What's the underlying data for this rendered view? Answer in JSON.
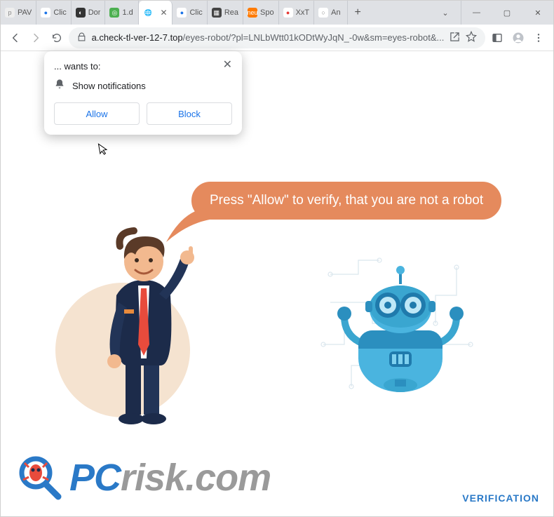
{
  "tabs": [
    {
      "label": "PAV",
      "fav": "p",
      "favbg": "#eee",
      "favcolor": "#888"
    },
    {
      "label": "Clic",
      "fav": "●",
      "favbg": "#fff",
      "favcolor": "#1a73e8"
    },
    {
      "label": "Dor",
      "fav": "◐",
      "favbg": "#333",
      "favcolor": "#fff"
    },
    {
      "label": "1.d",
      "fav": "◎",
      "favbg": "#4caf50",
      "favcolor": "#fff"
    },
    {
      "label": "",
      "fav": "🌐",
      "favbg": "#fff",
      "favcolor": "#555",
      "active": true
    },
    {
      "label": "Clic",
      "fav": "●",
      "favbg": "#fff",
      "favcolor": "#1a73e8"
    },
    {
      "label": "Rea",
      "fav": "▦",
      "favbg": "#444",
      "favcolor": "#fff"
    },
    {
      "label": "Spo",
      "fav": "neu",
      "favbg": "#ff7a00",
      "favcolor": "#fff"
    },
    {
      "label": "XxT",
      "fav": "●",
      "favbg": "#fff",
      "favcolor": "#e53935"
    },
    {
      "label": "An",
      "fav": "○",
      "favbg": "#fff",
      "favcolor": "#888"
    }
  ],
  "window": {
    "newtab": "+",
    "caret": "⌄",
    "min": "—",
    "max": "▢",
    "close": "✕"
  },
  "toolbar": {
    "url_host": "a.check-tl-ver-12-7.top",
    "url_path": "/eyes-robot/?pl=LNLbWtt01kODtWyJqN_-0w&sm=eyes-robot&..."
  },
  "permission": {
    "wants": "... wants to:",
    "label": "Show notifications",
    "allow": "Allow",
    "block": "Block"
  },
  "page": {
    "speech": "Press \"Allow\" to verify, that you are not a robot",
    "verification": "VERIFICATION",
    "logo_pc": "PC",
    "logo_rest": "risk.com"
  }
}
